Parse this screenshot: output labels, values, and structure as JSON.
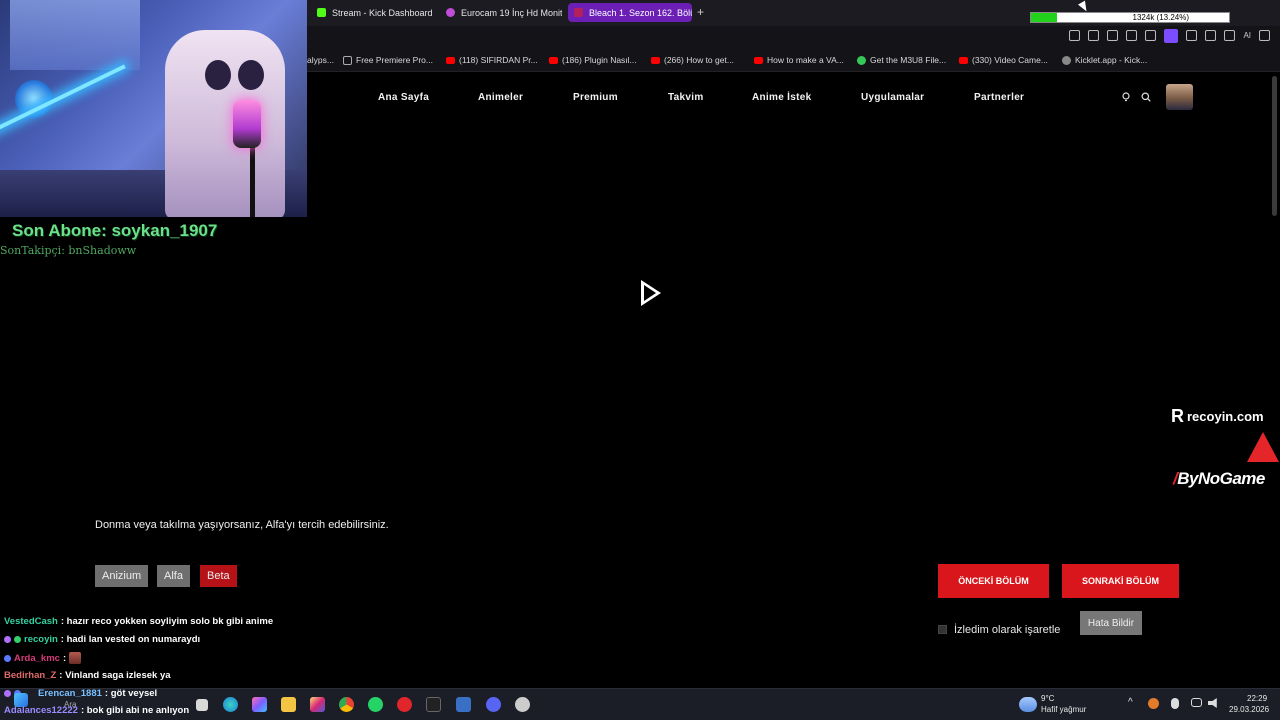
{
  "browser": {
    "tabs": [
      {
        "label": "Stream - Kick Dashboard",
        "color": "#53fc18"
      },
      {
        "label": "Eurocam 19 İnç Hd Monitö",
        "color": "#c04dd8"
      },
      {
        "label": "Bleach 1. Sezon 162. Bölüm",
        "color": "#b3205c"
      }
    ],
    "new_tab_icon": "+",
    "recording": {
      "text": "1324k (13.24%)",
      "progress": 0.1324
    },
    "bookmarks": [
      {
        "label": "alyps...",
        "icon": "none"
      },
      {
        "label": "Free Premiere Pro...",
        "icon": "page"
      },
      {
        "label": "(118) SIFIRDAN Pr...",
        "icon": "youtube"
      },
      {
        "label": "(186) Plugin Nasıl...",
        "icon": "youtube"
      },
      {
        "label": "(266) How to get...",
        "icon": "youtube"
      },
      {
        "label": "How to make a VA...",
        "icon": "youtube"
      },
      {
        "label": "Get the M3U8 File...",
        "icon": "green"
      },
      {
        "label": "(330) Video Came...",
        "icon": "youtube"
      },
      {
        "label": "Kicklet.app - Kick...",
        "icon": "kicklet"
      }
    ],
    "toolbar_ai_label": "AI"
  },
  "site": {
    "nav": [
      "Ana Sayfa",
      "Animeler",
      "Premium",
      "Takvim",
      "Anime İstek",
      "Uygulamalar",
      "Partnerler"
    ]
  },
  "stream_overlay": {
    "son_abone": "Son Abone: soykan_1907",
    "son_takipci": "SonTakipçi: bnShadoww",
    "sponsor1": "recoyin.com",
    "sponsor1_mark": "R",
    "sponsor2": "ByNoGame"
  },
  "player": {
    "notice": "Donma veya takılma yaşıyorsanız, Alfa'yı tercih edebilirsiniz.",
    "servers": [
      "Anizium",
      "Alfa",
      "Beta"
    ],
    "prev_episode": "ÖNCEKİ BÖLÜM",
    "next_episode": "SONRAKİ BÖLÜM",
    "watched_label": "İzledim olarak işaretle",
    "report_label": "Hata Bildir"
  },
  "chat": [
    {
      "user": "VestedCash",
      "color": "#35d0a0",
      "message": ": hazır reco yokken soyliyim solo bk gibi anime"
    },
    {
      "user": "recoyin",
      "color": "#35d0a0",
      "message": ": hadi lan vested on numaraydı"
    },
    {
      "user": "Arda_kmc",
      "color": "#d63b7a",
      "message": ":"
    },
    {
      "user": "Bedirhan_Z",
      "color": "#e06a6a",
      "message": ": Vinland saga izlesek ya"
    },
    {
      "user": "Erencan_1881",
      "color": "#7ac1ff",
      "message": ": göt veysel"
    },
    {
      "user": "Adalances12222",
      "color": "#9b8cff",
      "message": ": bok gibi abi ne anlıyon"
    }
  ],
  "taskbar": {
    "search_label": "Ara",
    "weather_temp": "9°C",
    "weather_desc": "Hafif yağmur",
    "time": "22:29",
    "date": "29.03.2026"
  }
}
